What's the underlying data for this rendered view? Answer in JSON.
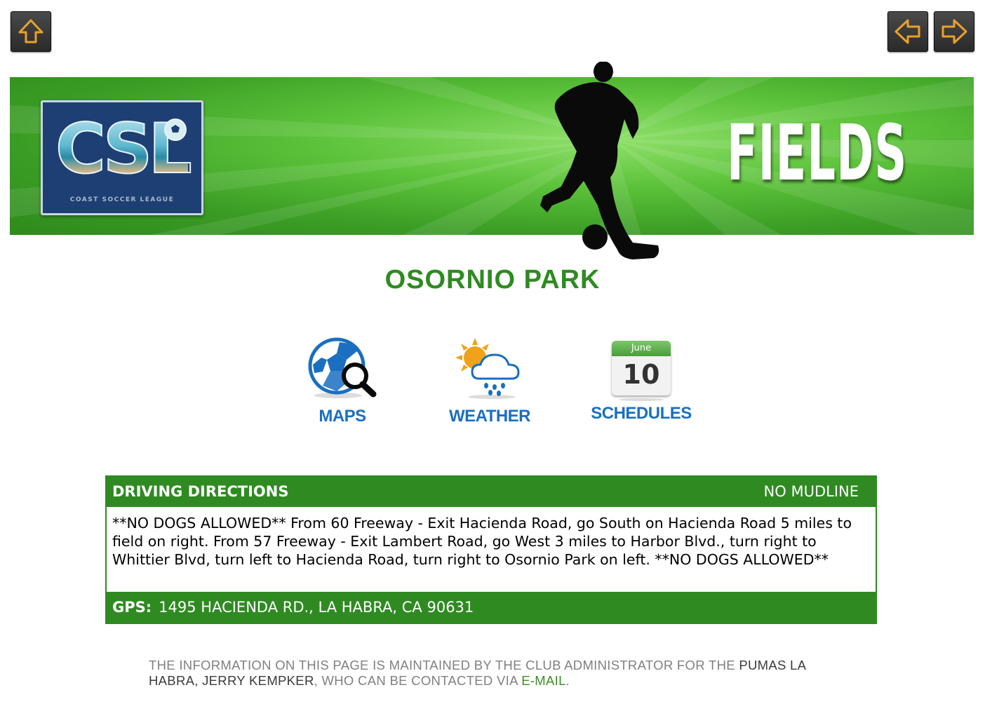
{
  "nav": {
    "home_icon": "home-arrow-icon",
    "prev_icon": "left-arrow-icon",
    "next_icon": "right-arrow-icon",
    "icon_color": "#e9a12a"
  },
  "banner": {
    "logo_letters": "CSL",
    "logo_subtitle": "COAST SOCCER LEAGUE",
    "title": "FIELDS",
    "green": "#4cb82e"
  },
  "park": {
    "name": "OSORNIO PARK",
    "color": "#2f8a22"
  },
  "tools": {
    "maps_label": "MAPS",
    "weather_label": "WEATHER",
    "schedules_label": "SCHEDULES",
    "calendar_month": "June",
    "calendar_day": "10",
    "label_color": "#1a6fc0"
  },
  "directions": {
    "heading": "DRIVING DIRECTIONS",
    "mudline": "NO MUDLINE",
    "text": "**NO DOGS ALLOWED** From 60 Freeway - Exit Hacienda Road, go South on Hacienda Road 5 miles to field on right. From 57 Freeway - Exit Lambert Road, go West 3 miles to Harbor Blvd., turn right to Whittier Blvd, turn left to Hacienda Road, turn right to Osornio Park on left. **NO DOGS ALLOWED**",
    "gps_label": "GPS:",
    "gps_address": "1495 HACIENDA RD., LA HABRA, CA 90631"
  },
  "footer": {
    "part1": "THE INFORMATION ON THIS PAGE IS MAINTAINED BY THE CLUB ADMINISTRATOR FOR THE ",
    "club": "PUMAS LA HABRA, JERRY KEMPKER",
    "part2": ", WHO CAN BE CONTACTED VIA ",
    "email_link": "E-MAIL",
    "part3": "."
  }
}
